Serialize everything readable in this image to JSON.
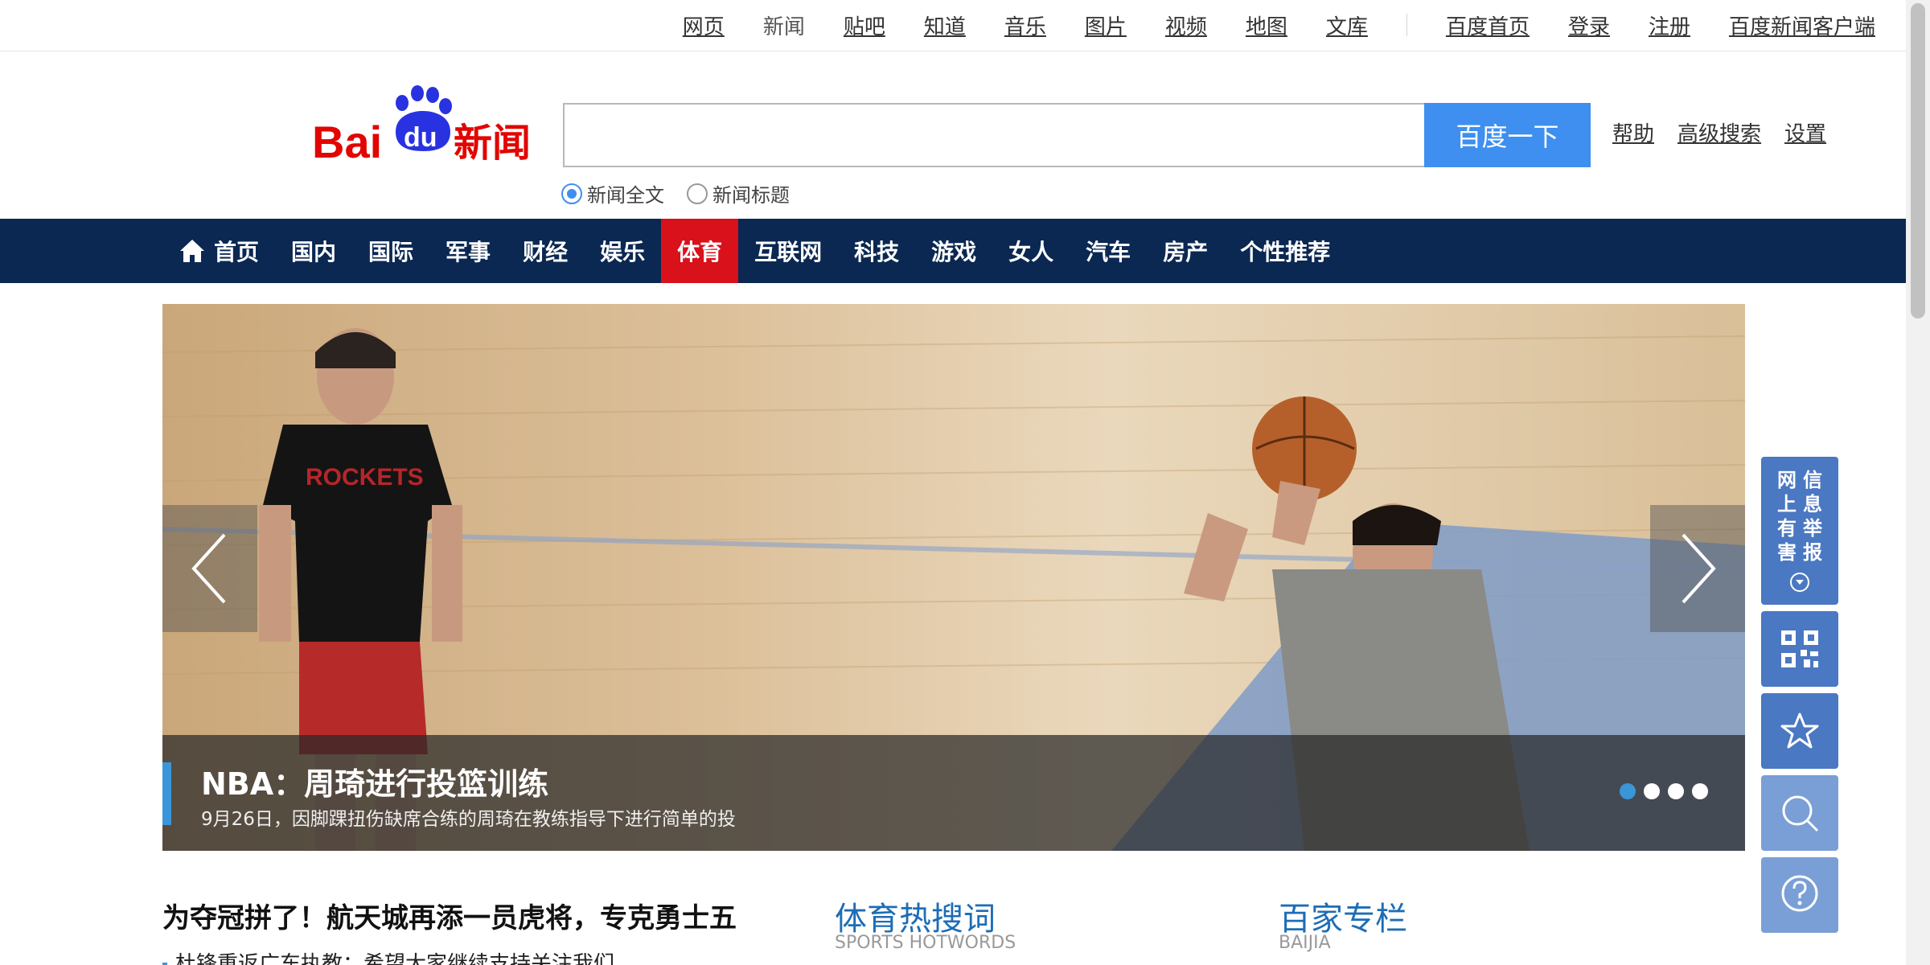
{
  "top_nav": {
    "links": [
      "网页",
      "新闻",
      "贴吧",
      "知道",
      "音乐",
      "图片",
      "视频",
      "地图",
      "文库"
    ],
    "current": "新闻",
    "right_links": [
      "百度首页",
      "登录",
      "注册",
      "百度新闻客户端"
    ]
  },
  "logo": {
    "text_bai": "Bai",
    "text_du": "du",
    "text_news": "新闻"
  },
  "search": {
    "value": "",
    "button_label": "百度一下",
    "links": [
      "帮助",
      "高级搜索",
      "设置"
    ],
    "options": [
      "新闻全文",
      "新闻标题"
    ],
    "selected_option": "新闻全文"
  },
  "main_nav": {
    "items": [
      "首页",
      "国内",
      "国际",
      "军事",
      "财经",
      "娱乐",
      "体育",
      "互联网",
      "科技",
      "游戏",
      "女人",
      "汽车",
      "房产",
      "个性推荐"
    ],
    "active": "体育"
  },
  "slider": {
    "title": "NBA：周琦进行投篮训练",
    "description": "9月26日，因脚踝扭伤缺席合练的周琦在教练指导下进行简单的投",
    "slide_count": 4,
    "current_slide": 1,
    "jersey_text": "ROCKETS"
  },
  "float_bar": {
    "report_chars": [
      "网",
      "上",
      "有",
      "害",
      "信",
      "息",
      "举",
      "报"
    ]
  },
  "bottom": {
    "headline": "为夺冠拼了！航天城再添一员虎将，专克勇士五",
    "sub_item": "杜锋重返广东执教：希望大家继续支持关注我们",
    "hotwords_title": "体育热搜词",
    "hotwords_sub": "SPORTS HOTWORDS",
    "baijia_title": "百家专栏",
    "baijia_sub": "BAIJIA"
  },
  "colors": {
    "nav_bg": "#0b2852",
    "nav_active": "#d8111b",
    "search_button": "#3e8fef",
    "float_bar": "#4a78c2",
    "caption_accent": "#3b95d9",
    "section_title": "#1d6db5"
  }
}
